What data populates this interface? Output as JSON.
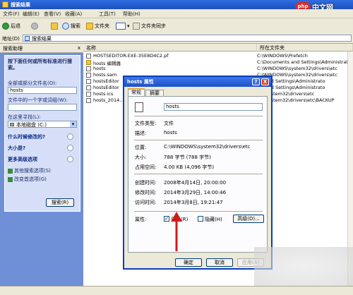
{
  "window": {
    "title": "搜索结果"
  },
  "menu": [
    "文件(F)",
    "编辑(E)",
    "查看(V)",
    "收藏(A)",
    "工具(T)",
    "帮助(H)"
  ],
  "toolbar": {
    "back": "后退",
    "search": "搜索",
    "folders": "文件夹",
    "sync": "文件夹同步"
  },
  "address": {
    "label": "地址(D)",
    "value": "搜索结果"
  },
  "search_pane": {
    "header": "搜索助理",
    "close": "x",
    "prompt": "按下面任何或所有标准进行搜索。",
    "name_label": "全部或部分文件名(O):",
    "name_value": "hosts",
    "word_label": "文件中的一个字或词组(W):",
    "word_value": "",
    "look_label": "在这里寻找(L):",
    "look_value": "本地磁盘 (C:)",
    "when_label": "什么时候修改的?",
    "size_label": "大小是?",
    "more_label": "更多高级选项",
    "other_options": "其他搜索选项(S)",
    "change_pref": "改变首选项(G)",
    "search_button": "搜索(R)"
  },
  "file_list": {
    "col_name": "名称",
    "col_folder": "所在文件夹",
    "rows": [
      {
        "name": "HOSTSEDITOR.EXE-35E8D4C2.pf",
        "folder": "C:\\WINDOWS\\Prefetch"
      },
      {
        "name": "hosts 编辑器",
        "folder": "C:\\Documents and Settings\\Administrato"
      },
      {
        "name": "hosts",
        "folder": "C:\\WINDOWS\\system32\\drivers\\etc"
      },
      {
        "name": "hosts.sam",
        "folder": "C:\\WINDOWS\\system32\\drivers\\etc"
      },
      {
        "name": "hostsEditor",
        "folder": "...s and Settings\\Administrato"
      },
      {
        "name": "hostsEditor",
        "folder": "...s and Settings\\Administrato"
      },
      {
        "name": "hosts.ics",
        "folder": "...S\\system32\\drivers\\etc"
      },
      {
        "name": "hosts_2014...",
        "folder": "...S\\system32\\drivers\\etc\\BACKUP"
      }
    ]
  },
  "dialog": {
    "title": "hosts 属性",
    "help": "?",
    "close": "X",
    "tab_general": "常规",
    "tab_summary": "摘要",
    "filename": "hosts",
    "type_label": "文件类型:",
    "type_value": "文件",
    "desc_label": "描述:",
    "desc_value": "hosts",
    "location_label": "位置:",
    "location_value": "C:\\WINDOWS\\system32\\drivers\\etc",
    "size_label": "大小:",
    "size_value": "788 字节 (788 字节)",
    "disk_label": "占用空间:",
    "disk_value": "4.00 KB (4,096 字节)",
    "created_label": "创建时间:",
    "created_value": "2008年4月14日, 20:00:00",
    "modified_label": "修改时间:",
    "modified_value": "2014年3月29日, 14:00:46",
    "accessed_label": "访问时间:",
    "accessed_value": "2014年3月8日, 19:21:47",
    "attr_label": "属性:",
    "readonly_label": "只读(R)",
    "hidden_label": "隐藏(H)",
    "advanced_button": "高级(D)...",
    "ok_button": "确定",
    "cancel_button": "取消",
    "apply_button": "应用(A)"
  },
  "watermark": "php中文网",
  "colors": {
    "xp_blue": "#1c4fc2",
    "pane_blue": "#6f8fd6",
    "dialog_bg": "#ece9d8",
    "arrow_red": "#d11a1a"
  }
}
